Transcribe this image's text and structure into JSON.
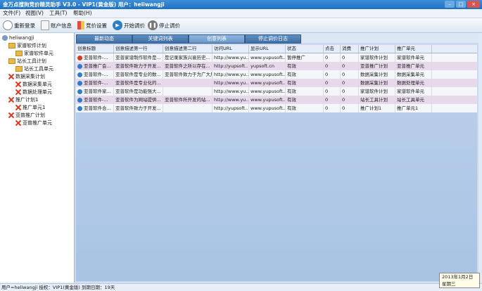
{
  "window": {
    "title": "金万点搜狗竞价精灵助手 V3.0 - VIP1(黄金版) 用户：heliwangji",
    "min": "–",
    "max": "□",
    "close": "×"
  },
  "menu": [
    "文件(F)",
    "视图(V)",
    "工具(T)",
    "帮助(H)"
  ],
  "toolbar": {
    "relogin": "重新登录",
    "account": "账户信息",
    "bid_settings": "竞价设置",
    "start": "开始调价",
    "stop": "停止调价"
  },
  "tree": [
    {
      "label": "heliwangji",
      "icon": "user",
      "level": 0
    },
    {
      "label": "家谱软件计划",
      "icon": "folder",
      "level": 1
    },
    {
      "label": "家谱软件单元",
      "icon": "folder",
      "level": 2
    },
    {
      "label": "站长工具计划",
      "icon": "folder",
      "level": 1
    },
    {
      "label": "站长工具单元",
      "icon": "folder",
      "level": 2
    },
    {
      "label": "数据采集计划",
      "icon": "x",
      "level": 1
    },
    {
      "label": "数据采集单元",
      "icon": "x",
      "level": 2
    },
    {
      "label": "数据处理单元",
      "icon": "x",
      "level": 2
    },
    {
      "label": "推广计划1",
      "icon": "x",
      "level": 1
    },
    {
      "label": "推广单元1",
      "icon": "x",
      "level": 2
    },
    {
      "label": "亚普推广计划",
      "icon": "x",
      "level": 1
    },
    {
      "label": "亚普推广单元",
      "icon": "x",
      "level": 2
    }
  ],
  "tabs": [
    "最新动态",
    "关键词列表",
    "创意列表",
    "停止调价日志"
  ],
  "table": {
    "columns": [
      "创意标题",
      "创意描述第一行",
      "创意描述第二行",
      "访问URL",
      "显示URL",
      "状态",
      "点击",
      "消费",
      "推广计划",
      "推广单元"
    ],
    "rows": [
      [
        "亚普软件-...",
        "亚普家谱制作软件是...",
        "是记录家族兴衰历史...",
        "http://www.yu...",
        "www.yupusoft...",
        "暂停推广",
        "0",
        "0",
        "家谱软件计划",
        "家谱软件单元"
      ],
      [
        "亚普推广会...",
        "亚普软件致力于开发...",
        "亚普软件之所以存在...",
        "http://yupsoft...",
        "yupsoft.cn",
        "有效",
        "0",
        "0",
        "亚普推广计划",
        "亚普推广单元"
      ],
      [
        "亚普软件-...",
        "亚普软件是专业的数...",
        "亚普软件致力于为广大用...",
        "http://www.yu...",
        "www.yupusoft...",
        "有效",
        "0",
        "0",
        "数据采集计划",
        "数据采集单元"
      ],
      [
        "亚普软件-...",
        "亚普软件是专业化的...",
        "",
        "http://www.yu...",
        "www.yupusoft...",
        "有效",
        "0",
        "0",
        "数据采集计划",
        "数据处理单元"
      ],
      [
        "亚普软件家...",
        "亚普软件是功能强大...",
        "",
        "http://www.yu...",
        "www.yupusoft...",
        "有效",
        "0",
        "0",
        "家谱软件计划",
        "家谱软件单元"
      ],
      [
        "亚普软件-...",
        "亚普软件为网站提供...",
        "亚普软件所开发的站...",
        "http://www.yu...",
        "www.yupusoft...",
        "有效",
        "0",
        "0",
        "站长工具计划",
        "站长工具单元"
      ],
      [
        "亚普软件合...",
        "亚普软件致力于开发...",
        "",
        "http://yupsoft...",
        "www.yupusoft...",
        "有效",
        "0",
        "0",
        "推广计划1",
        "推广单元1"
      ]
    ],
    "row_icons": [
      "red",
      "blue",
      "blue",
      "blue",
      "blue",
      "blue",
      "blue"
    ]
  },
  "statusbar": "用户=heliwangji 授权：VIP1(黄金版) 到期日期：19天",
  "clock": {
    "date": "2013年1月2日",
    "weekday": "星期三"
  },
  "colors": {
    "accent": "#1d6fc2",
    "row_alt": "#e7d9ea",
    "grid_bg": "#a8c3e3"
  }
}
